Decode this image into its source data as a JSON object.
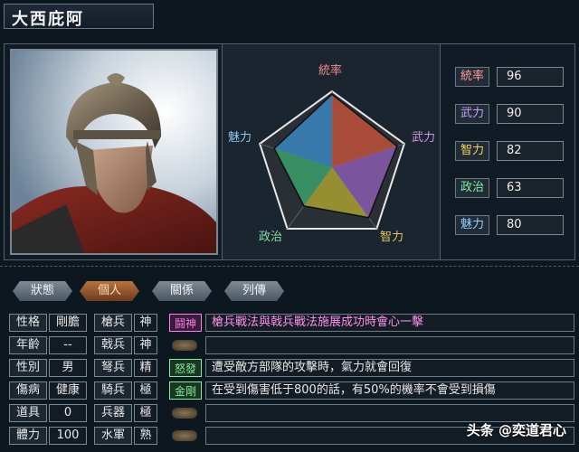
{
  "character": {
    "name": "大西庇阿"
  },
  "radar": {
    "labels": [
      "統率",
      "武力",
      "智力",
      "政治",
      "魅力"
    ],
    "values": [
      96,
      90,
      82,
      63,
      80
    ],
    "max": 100,
    "colors": [
      "#f08a8a",
      "#c89ae0",
      "#e3c45a",
      "#7fe29c",
      "#8dc8ef"
    ]
  },
  "stats": [
    {
      "label": "統率",
      "value": "96",
      "color": "#ff9d9d"
    },
    {
      "label": "武力",
      "value": "90",
      "color": "#c89cff"
    },
    {
      "label": "智力",
      "value": "82",
      "color": "#f0d45a"
    },
    {
      "label": "政治",
      "value": "63",
      "color": "#7ff0a0"
    },
    {
      "label": "魅力",
      "value": "80",
      "color": "#8fd0ff"
    }
  ],
  "tabs": [
    {
      "label": "狀態",
      "active": false
    },
    {
      "label": "個人",
      "active": true
    },
    {
      "label": "關係",
      "active": false
    },
    {
      "label": "列傳",
      "active": false
    }
  ],
  "personal": [
    {
      "label": "性格",
      "value": "剛膽"
    },
    {
      "label": "年齡",
      "value": "--"
    },
    {
      "label": "性別",
      "value": "男"
    },
    {
      "label": "傷病",
      "value": "健康"
    },
    {
      "label": "道具",
      "value": "0"
    },
    {
      "label": "體力",
      "value": "100"
    }
  ],
  "troops": [
    {
      "label": "槍兵",
      "value": "神"
    },
    {
      "label": "戟兵",
      "value": "神"
    },
    {
      "label": "弩兵",
      "value": "精"
    },
    {
      "label": "騎兵",
      "value": "極"
    },
    {
      "label": "兵器",
      "value": "極"
    },
    {
      "label": "水軍",
      "value": "熟"
    }
  ],
  "skills": [
    {
      "tag": "鬪神",
      "tag_color": "#ff7de6",
      "desc": "槍兵戰法與戟兵戰法施展成功時會心一擊",
      "desc_color": "#ff8fe8"
    },
    {
      "tag": "",
      "tag_color": "",
      "desc": "",
      "desc_color": ""
    },
    {
      "tag": "怒發",
      "tag_color": "#7ef09a",
      "desc": "遭受敵方部隊的攻擊時，氣力就會回復",
      "desc_color": "#e8e8e8"
    },
    {
      "tag": "金剛",
      "tag_color": "#7ef09a",
      "desc": "在受到傷害低于800的話，有50%的機率不會受到損傷",
      "desc_color": "#e8e8e8"
    },
    {
      "tag": "",
      "tag_color": "",
      "desc": "",
      "desc_color": ""
    },
    {
      "tag": "",
      "tag_color": "",
      "desc": "",
      "desc_color": ""
    }
  ],
  "watermark": "头条 @奕道君心"
}
